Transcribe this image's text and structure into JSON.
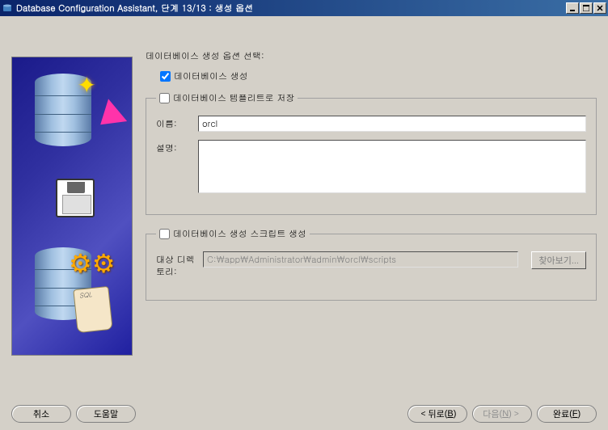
{
  "titlebar": {
    "title": "Database Configuration Assistant, 단계 13/13 : 생성 옵션"
  },
  "main": {
    "option_title": "데이터베이스 생성 옵션 선택:",
    "create_db_label": "데이터베이스 생성",
    "save_template_group": {
      "legend": "데이터베이스 템플리트로 저장",
      "name_label": "이름:",
      "name_value": "orcl",
      "desc_label": "설명:",
      "desc_value": ""
    },
    "script_group": {
      "legend": "데이터베이스 생성 스크립트 생성",
      "dest_label": "대상 디렉토리:",
      "dest_value": "C:\\app\\Administrator\\admin\\orcl\\scripts",
      "browse_label": "찾아보기..."
    }
  },
  "footer": {
    "cancel": "취소",
    "help": "도움말",
    "back": "뒤로",
    "back_key": "B",
    "next": "다음",
    "next_key": "N",
    "finish": "완료",
    "finish_key": "F"
  }
}
